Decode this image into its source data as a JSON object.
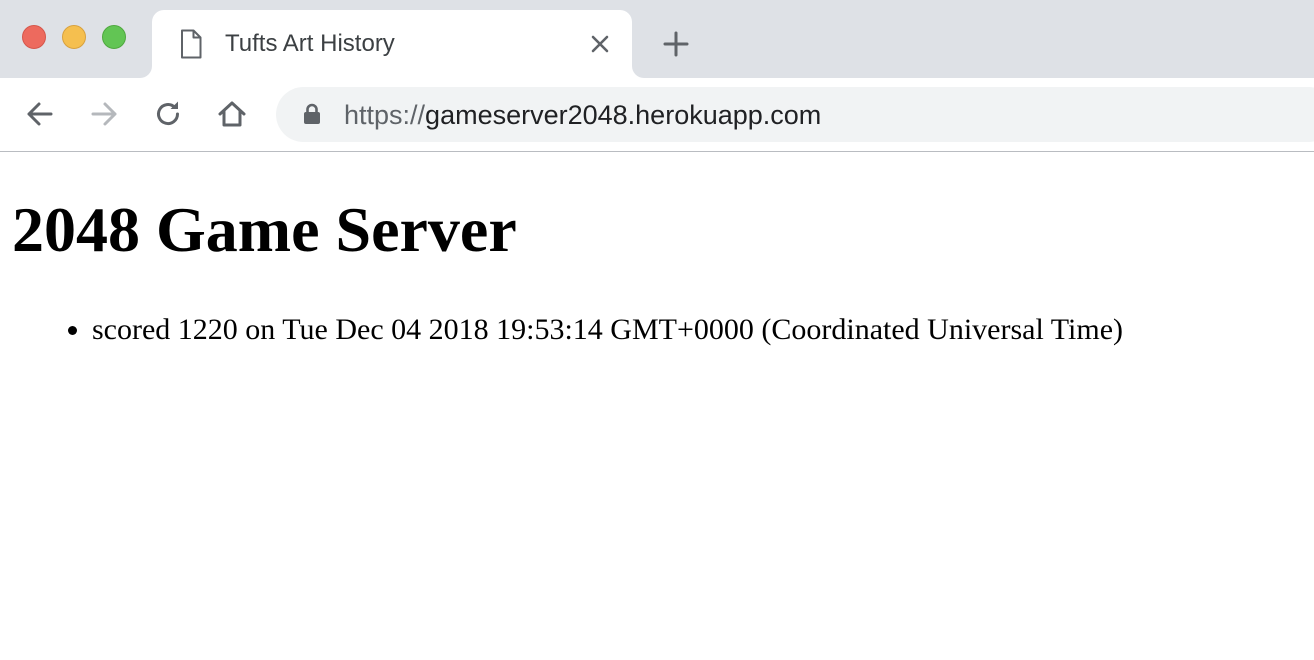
{
  "browser": {
    "tab": {
      "title": "Tufts Art History",
      "icon": "page-icon"
    },
    "address_bar": {
      "scheme": "https://",
      "host": "gameserver2048.herokuapp.com"
    },
    "icons": {
      "back": "back-arrow-icon",
      "forward": "forward-arrow-icon",
      "reload": "reload-icon",
      "home": "home-icon",
      "lock": "lock-icon",
      "close_tab": "close-icon",
      "new_tab": "plus-icon"
    },
    "colors": {
      "tab_strip": "#dee1e6",
      "omnibox": "#f1f3f4",
      "traffic_close": "#ed6a5e",
      "traffic_minimize": "#f5bf4f",
      "traffic_maximize": "#62c554"
    }
  },
  "page": {
    "heading": "2048 Game Server",
    "scores": [
      "scored 1220 on Tue Dec 04 2018 19:53:14 GMT+0000 (Coordinated Universal Time)"
    ]
  }
}
